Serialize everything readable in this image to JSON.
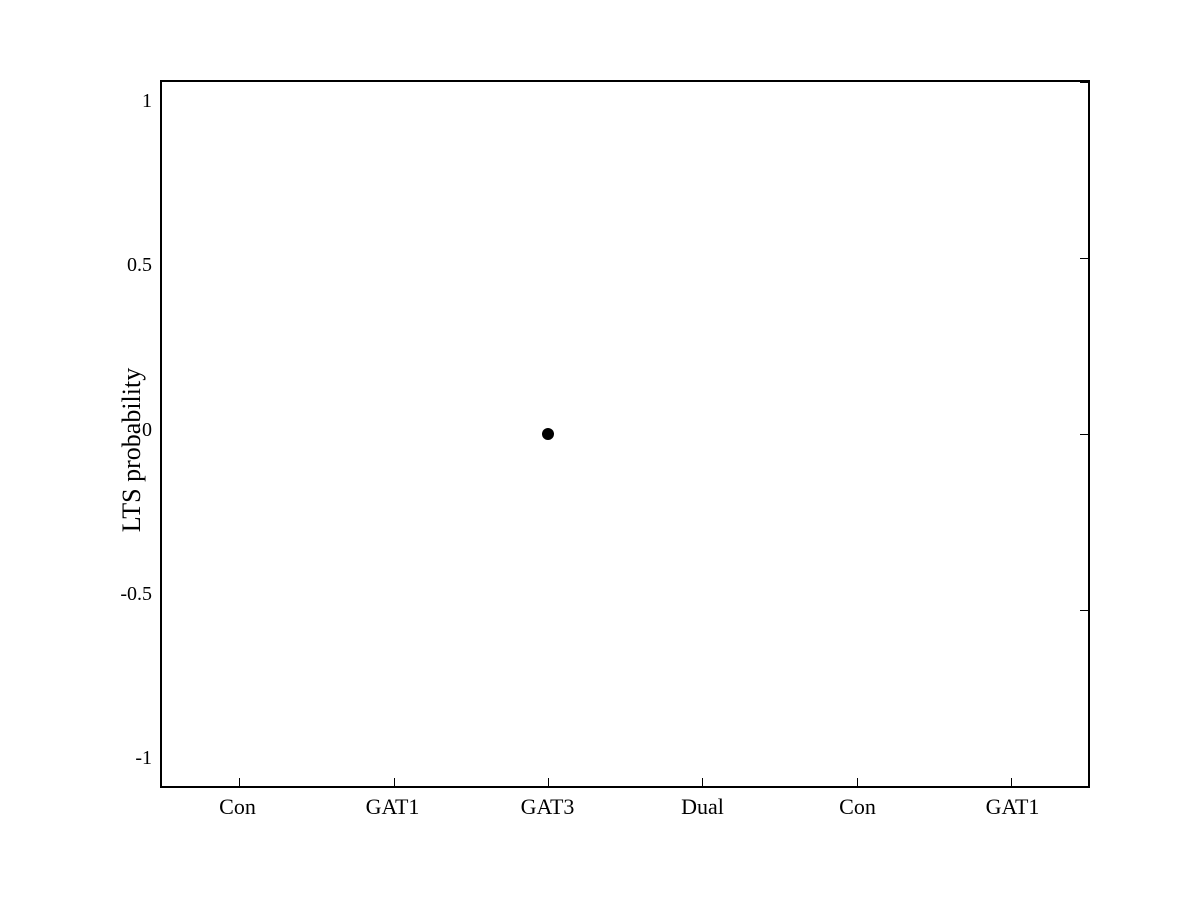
{
  "chart": {
    "y_axis_label": "LTS probability",
    "y_ticks": [
      "1",
      "0.5",
      "0",
      "-0.5",
      "-1"
    ],
    "x_ticks": [
      "Con",
      "GAT1",
      "GAT3",
      "Dual",
      "Con",
      "GAT1"
    ],
    "data_points": [
      {
        "label": "GAT3 ~0",
        "x_category_index": 2,
        "y_value": 0.0,
        "x_percent": 40,
        "y_percent": 50
      }
    ]
  }
}
